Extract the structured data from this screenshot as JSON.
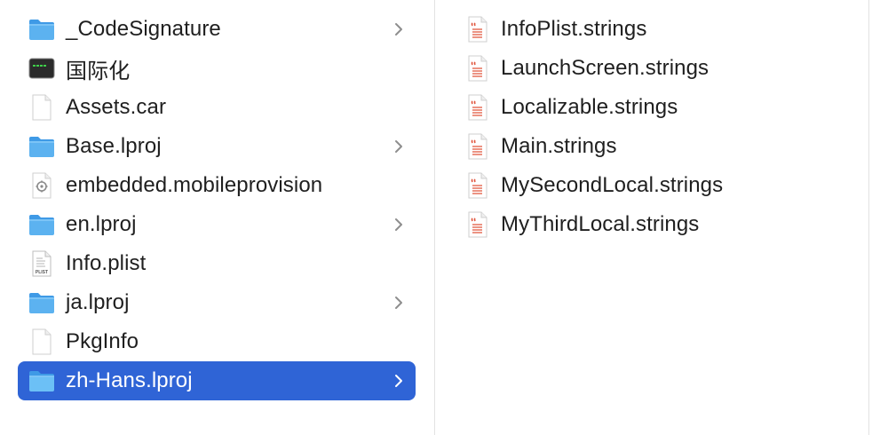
{
  "left_column": {
    "items": [
      {
        "label": "_CodeSignature",
        "icon": "folder-icon",
        "has_children": true
      },
      {
        "label": "国际化",
        "icon": "app-terminal-icon",
        "has_children": false
      },
      {
        "label": "Assets.car",
        "icon": "document-icon",
        "has_children": false
      },
      {
        "label": "Base.lproj",
        "icon": "folder-icon",
        "has_children": true
      },
      {
        "label": "embedded.mobileprovision",
        "icon": "provision-icon",
        "has_children": false
      },
      {
        "label": "en.lproj",
        "icon": "folder-icon",
        "has_children": true
      },
      {
        "label": "Info.plist",
        "icon": "plist-icon",
        "has_children": false,
        "icon_text": "PLIST"
      },
      {
        "label": "ja.lproj",
        "icon": "folder-icon",
        "has_children": true
      },
      {
        "label": "PkgInfo",
        "icon": "document-icon",
        "has_children": false
      },
      {
        "label": "zh-Hans.lproj",
        "icon": "folder-icon",
        "has_children": true,
        "selected": true
      }
    ]
  },
  "right_column": {
    "items": [
      {
        "label": "InfoPlist.strings",
        "icon": "strings-file-icon"
      },
      {
        "label": "LaunchScreen.strings",
        "icon": "strings-file-icon"
      },
      {
        "label": "Localizable.strings",
        "icon": "strings-file-icon"
      },
      {
        "label": "Main.strings",
        "icon": "strings-file-icon"
      },
      {
        "label": "MySecondLocal.strings",
        "icon": "strings-file-icon"
      },
      {
        "label": "MyThirdLocal.strings",
        "icon": "strings-file-icon"
      }
    ]
  },
  "colors": {
    "selection": "#2f64d6",
    "folder": "#5cb2f0",
    "strings_accent": "#e0533b"
  }
}
